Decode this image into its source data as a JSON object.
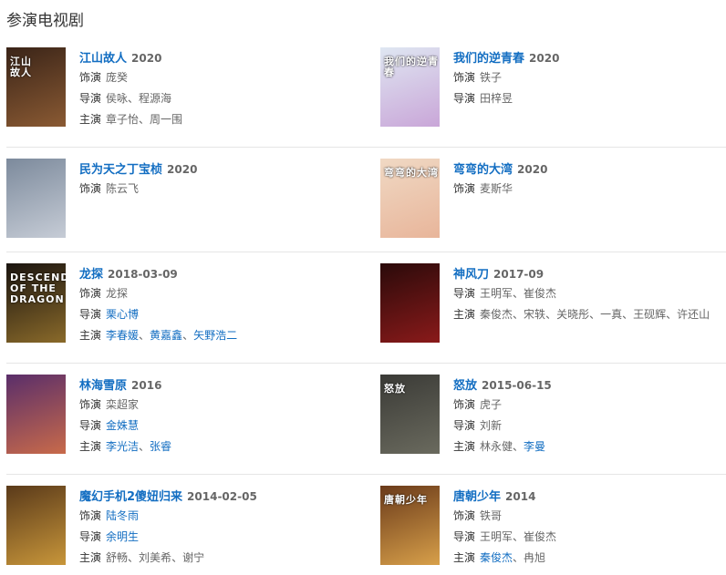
{
  "section": {
    "title": "参演电视剧"
  },
  "rows": [
    [
      {
        "title": "江山故人",
        "year": "2020",
        "poster_text": "江山\n故人",
        "poster_colors": [
          "#3a2418",
          "#8a5a33"
        ],
        "lines": [
          {
            "label": "饰演",
            "items": [
              {
                "text": "庞癸",
                "link": false
              }
            ]
          },
          {
            "label": "导演",
            "items": [
              {
                "text": "侯咏",
                "link": false
              },
              {
                "text": "程源海",
                "link": false
              }
            ]
          },
          {
            "label": "主演",
            "items": [
              {
                "text": "章子怡",
                "link": false
              },
              {
                "text": "周一围",
                "link": false
              }
            ]
          }
        ]
      },
      {
        "title": "我们的逆青春",
        "year": "2020",
        "poster_text": "我们的逆青春",
        "poster_colors": [
          "#dfe7f2",
          "#c9a6d8"
        ],
        "lines": [
          {
            "label": "饰演",
            "items": [
              {
                "text": "铁子",
                "link": false
              }
            ]
          },
          {
            "label": "导演",
            "items": [
              {
                "text": "田梓昱",
                "link": false
              }
            ]
          }
        ]
      }
    ],
    [
      {
        "title": "民为天之丁宝桢",
        "year": "2020",
        "poster_text": "",
        "poster_colors": [
          "#7c8a9c",
          "#c6ccd6"
        ],
        "lines": [
          {
            "label": "饰演",
            "items": [
              {
                "text": "陈云飞",
                "link": false
              }
            ]
          }
        ]
      },
      {
        "title": "弯弯的大湾",
        "year": "2020",
        "poster_text": "弯弯的大湾",
        "poster_colors": [
          "#f0d9c4",
          "#e8b59a"
        ],
        "lines": [
          {
            "label": "饰演",
            "items": [
              {
                "text": "麦斯华",
                "link": false
              }
            ]
          }
        ]
      }
    ],
    [
      {
        "title": "龙探",
        "year": "2018-03-09",
        "poster_text": "DESCENDANTS\nOF THE\nDRAGON",
        "poster_colors": [
          "#1a1410",
          "#8a6a2a"
        ],
        "lines": [
          {
            "label": "饰演",
            "items": [
              {
                "text": "龙探",
                "link": false
              }
            ]
          },
          {
            "label": "导演",
            "items": [
              {
                "text": "栗心博",
                "link": true
              }
            ]
          },
          {
            "label": "主演",
            "items": [
              {
                "text": "李春媛",
                "link": true
              },
              {
                "text": "黄嘉鑫",
                "link": true
              },
              {
                "text": "矢野浩二",
                "link": true
              }
            ]
          }
        ]
      },
      {
        "title": "神风刀",
        "year": "2017-09",
        "poster_text": "",
        "poster_colors": [
          "#2a0a0a",
          "#8a1a1a"
        ],
        "lines": [
          {
            "label": "导演",
            "items": [
              {
                "text": "王明军",
                "link": false
              },
              {
                "text": "崔俊杰",
                "link": false
              }
            ]
          },
          {
            "label": "主演",
            "items": [
              {
                "text": "秦俊杰",
                "link": false
              },
              {
                "text": "宋轶",
                "link": false
              },
              {
                "text": "关晓彤",
                "link": false
              },
              {
                "text": "一真",
                "link": false
              },
              {
                "text": "王砚辉",
                "link": false
              },
              {
                "text": "许还山",
                "link": false
              }
            ]
          }
        ]
      }
    ],
    [
      {
        "title": "林海雪原",
        "year": "2016",
        "poster_text": "",
        "poster_colors": [
          "#5a2e6a",
          "#c86a4a"
        ],
        "lines": [
          {
            "label": "饰演",
            "items": [
              {
                "text": "栾超家",
                "link": false
              }
            ]
          },
          {
            "label": "导演",
            "items": [
              {
                "text": "金姝慧",
                "link": true
              }
            ]
          },
          {
            "label": "主演",
            "items": [
              {
                "text": "李光洁",
                "link": true
              },
              {
                "text": "张睿",
                "link": true
              }
            ]
          }
        ]
      },
      {
        "title": "怒放",
        "year": "2015-06-15",
        "poster_text": "怒放",
        "poster_colors": [
          "#3a3a36",
          "#6a6a5e"
        ],
        "lines": [
          {
            "label": "饰演",
            "items": [
              {
                "text": "虎子",
                "link": false
              }
            ]
          },
          {
            "label": "导演",
            "items": [
              {
                "text": "刘新",
                "link": false
              }
            ]
          },
          {
            "label": "主演",
            "items": [
              {
                "text": "林永健",
                "link": false
              },
              {
                "text": "李曼",
                "link": true
              }
            ]
          }
        ]
      }
    ],
    [
      {
        "title": "魔幻手机2傻妞归来",
        "year": "2014-02-05",
        "poster_text": "",
        "poster_colors": [
          "#5a3a1a",
          "#c8963a"
        ],
        "lines": [
          {
            "label": "饰演",
            "items": [
              {
                "text": "陆冬雨",
                "link": true
              }
            ]
          },
          {
            "label": "导演",
            "items": [
              {
                "text": "余明生",
                "link": true
              }
            ]
          },
          {
            "label": "主演",
            "items": [
              {
                "text": "舒畅",
                "link": false
              },
              {
                "text": "刘美希",
                "link": false
              },
              {
                "text": "谢宁",
                "link": false
              }
            ]
          }
        ]
      },
      {
        "title": "唐朝少年",
        "year": "2014",
        "poster_text": "唐朝少年",
        "poster_colors": [
          "#6a3a1a",
          "#d8a04a"
        ],
        "lines": [
          {
            "label": "饰演",
            "items": [
              {
                "text": "铁哥",
                "link": false
              }
            ]
          },
          {
            "label": "导演",
            "items": [
              {
                "text": "王明军",
                "link": false
              },
              {
                "text": "崔俊杰",
                "link": false
              }
            ]
          },
          {
            "label": "主演",
            "items": [
              {
                "text": "秦俊杰",
                "link": true
              },
              {
                "text": "冉旭",
                "link": false
              }
            ]
          }
        ]
      }
    ]
  ],
  "separator": "、",
  "colors": {
    "link": "#136ec2",
    "text": "#666666",
    "label": "#333333",
    "divider": "#e6e6e6"
  }
}
